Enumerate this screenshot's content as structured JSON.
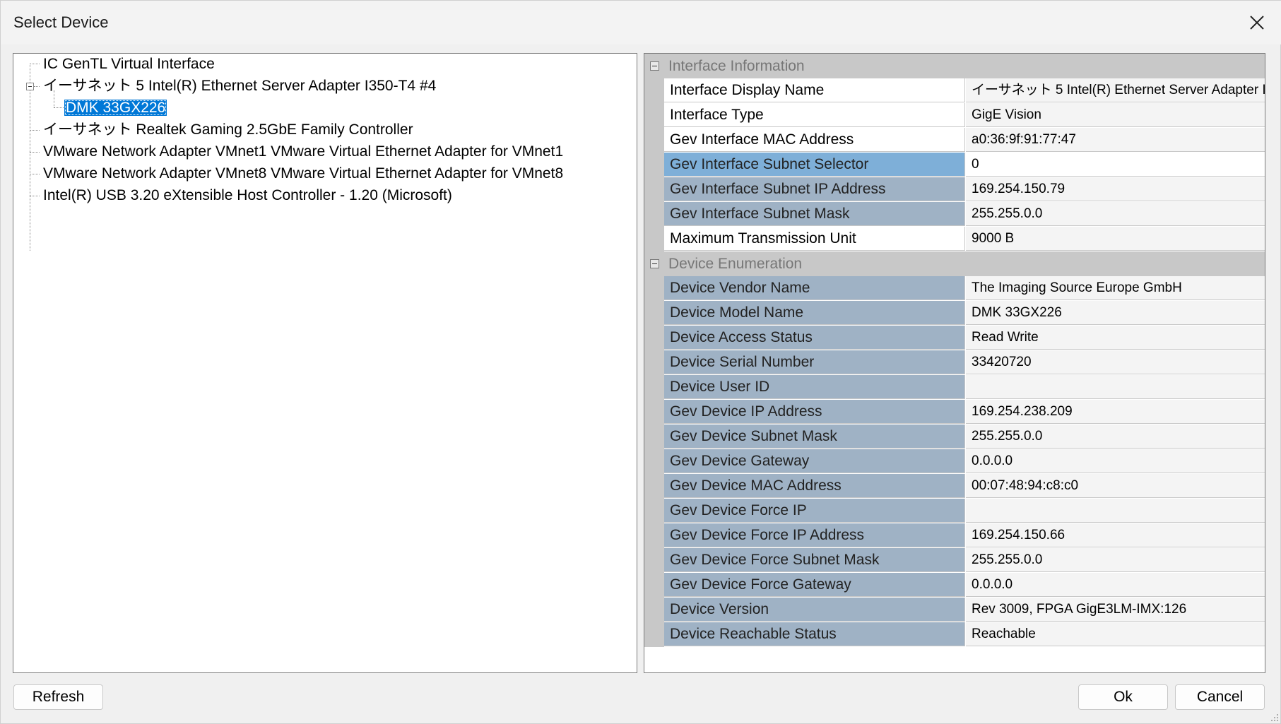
{
  "window": {
    "title": "Select Device"
  },
  "tree": {
    "items": [
      {
        "label": "IC GenTL Virtual Interface"
      },
      {
        "label": "イーサネット 5 Intel(R) Ethernet Server Adapter I350-T4 #4"
      },
      {
        "label": "DMK 33GX226"
      },
      {
        "label": "イーサネット Realtek Gaming 2.5GbE Family Controller"
      },
      {
        "label": "VMware Network Adapter VMnet1 VMware Virtual Ethernet Adapter for VMnet1"
      },
      {
        "label": "VMware Network Adapter VMnet8 VMware Virtual Ethernet Adapter for VMnet8"
      },
      {
        "label": "Intel(R) USB 3.20 eXtensible Host Controller - 1.20 (Microsoft)"
      }
    ]
  },
  "properties": {
    "interface": {
      "category": "Interface Information",
      "rows": [
        {
          "name": "Interface Display Name",
          "value": "イーサネット 5 Intel(R) Ethernet Server Adapter I3"
        },
        {
          "name": "Interface Type",
          "value": "GigE Vision"
        },
        {
          "name": "Gev Interface MAC Address",
          "value": "a0:36:9f:91:77:47"
        },
        {
          "name": "Gev Interface Subnet Selector",
          "value": "0"
        },
        {
          "name": "Gev Interface Subnet IP Address",
          "value": "169.254.150.79"
        },
        {
          "name": "Gev Interface Subnet Mask",
          "value": "255.255.0.0"
        },
        {
          "name": "Maximum Transmission Unit",
          "value": "9000 B"
        }
      ]
    },
    "device": {
      "category": "Device Enumeration",
      "rows": [
        {
          "name": "Device Vendor Name",
          "value": "The Imaging Source Europe GmbH"
        },
        {
          "name": "Device Model Name",
          "value": "DMK 33GX226"
        },
        {
          "name": "Device Access Status",
          "value": "Read Write"
        },
        {
          "name": "Device Serial Number",
          "value": "33420720"
        },
        {
          "name": "Device User ID",
          "value": ""
        },
        {
          "name": "Gev Device IP Address",
          "value": "169.254.238.209"
        },
        {
          "name": "Gev Device Subnet Mask",
          "value": "255.255.0.0"
        },
        {
          "name": "Gev Device Gateway",
          "value": "0.0.0.0"
        },
        {
          "name": "Gev Device MAC Address",
          "value": "00:07:48:94:c8:c0"
        },
        {
          "name": "Gev Device Force IP",
          "value": ""
        },
        {
          "name": "Gev Device Force IP Address",
          "value": "169.254.150.66"
        },
        {
          "name": "Gev Device Force Subnet Mask",
          "value": "255.255.0.0"
        },
        {
          "name": "Gev Device Force Gateway",
          "value": "0.0.0.0"
        },
        {
          "name": "Device Version",
          "value": "Rev 3009, FPGA GigE3LM-IMX:126"
        },
        {
          "name": "Device Reachable Status",
          "value": "Reachable"
        }
      ]
    }
  },
  "buttons": {
    "refresh": "Refresh",
    "ok": "Ok",
    "cancel": "Cancel"
  }
}
